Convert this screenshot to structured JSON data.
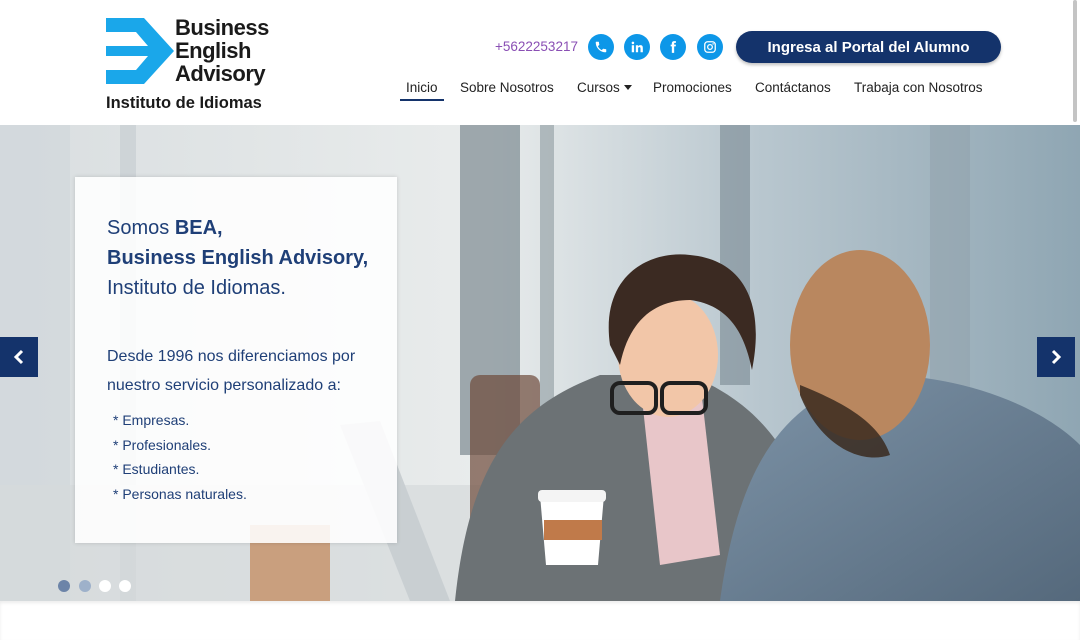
{
  "header": {
    "logo": {
      "word1": "Business",
      "word2": "English",
      "word3": "Advisory",
      "subtitle": "Instituto de Idiomas",
      "mark_color": "#1aa7ea"
    },
    "phone": "+5622253217",
    "social": [
      {
        "icon": "phone-icon"
      },
      {
        "icon": "linkedin-icon"
      },
      {
        "icon": "facebook-icon"
      },
      {
        "icon": "instagram-icon"
      }
    ],
    "portal_button": "Ingresa al Portal del Alumno",
    "nav": {
      "inicio": "Inicio",
      "sobre": "Sobre Nosotros",
      "cursos": "Cursos",
      "promociones": "Promociones",
      "contactanos": "Contáctanos",
      "trabaja": "Trabaja con Nosotros"
    }
  },
  "hero": {
    "card": {
      "h_pre": "Somos ",
      "h_bold1": "BEA,",
      "h_bold2": "Business English Advisory,",
      "h_post": " Instituto de Idiomas.",
      "paragraph": "Desde 1996 nos diferenciamos por nuestro servicio personalizado a:",
      "list": [
        "* Empresas.",
        "* Profesionales.",
        "* Estudiantes.",
        "* Personas naturales."
      ]
    },
    "slides": 4,
    "active_slide": 1
  },
  "colors": {
    "primary": "#14336b",
    "social": "#0d97e8",
    "phone_text": "#8a4fb4",
    "card_text": "#1f3f77"
  }
}
